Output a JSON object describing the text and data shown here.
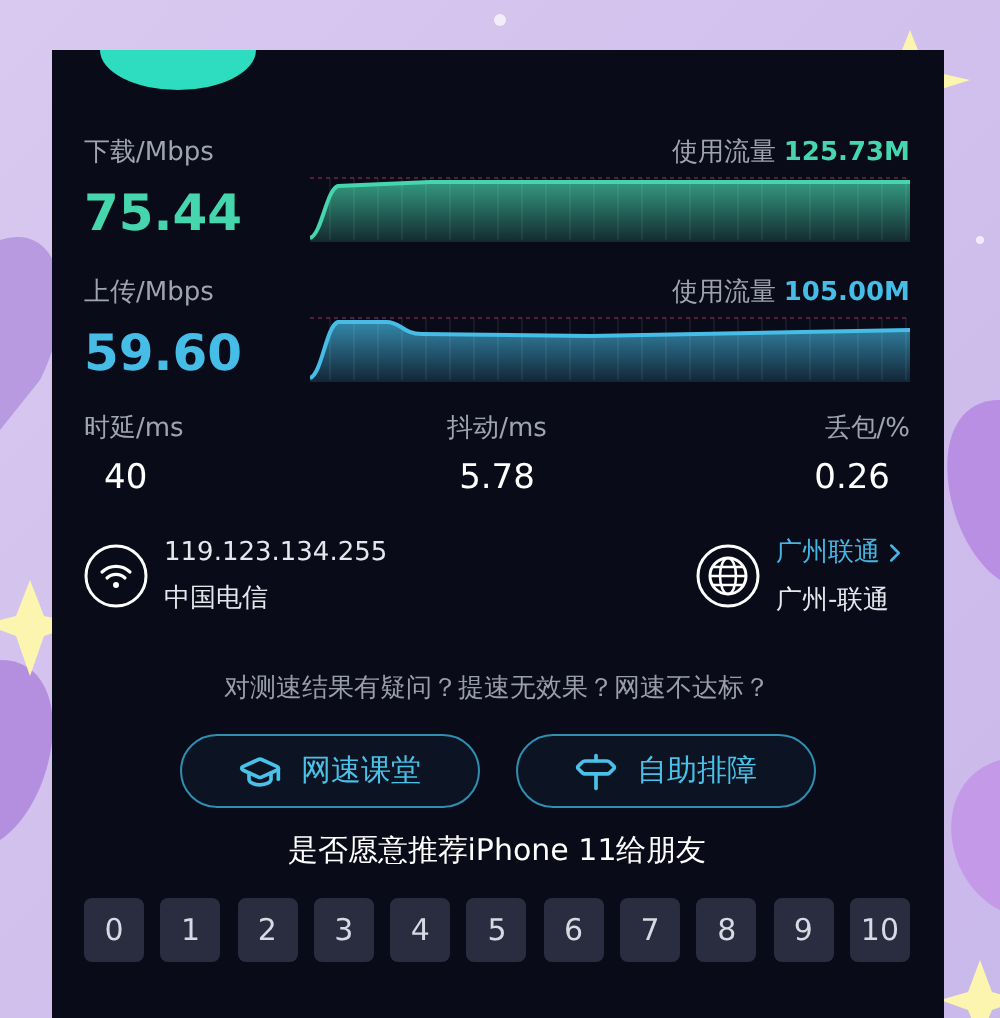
{
  "tests": [
    {
      "kind": "download",
      "label": "下载/Mbps",
      "value": "75.44",
      "usage_label": "使用流量",
      "usage": "125.73M"
    },
    {
      "kind": "upload",
      "label": "上传/Mbps",
      "value": "59.60",
      "usage_label": "使用流量",
      "usage": "105.00M"
    }
  ],
  "metrics": [
    {
      "label": "时延/ms",
      "value": "40"
    },
    {
      "label": "抖动/ms",
      "value": "5.78"
    },
    {
      "label": "丢包/%",
      "value": "0.26"
    }
  ],
  "network": {
    "ip": "119.123.134.255",
    "isp": "中国电信"
  },
  "server": {
    "name": "广州联通",
    "location": "广州-联通"
  },
  "question": "对测速结果有疑问？提速无效果？网速不达标？",
  "buttons": [
    {
      "kind": "course",
      "label": "网速课堂"
    },
    {
      "kind": "troubleshoot",
      "label": "自助排障"
    }
  ],
  "recommend": "是否愿意推荐iPhone 11给朋友",
  "scores": [
    "0",
    "1",
    "2",
    "3",
    "4",
    "5",
    "6",
    "7",
    "8",
    "9",
    "10"
  ]
}
